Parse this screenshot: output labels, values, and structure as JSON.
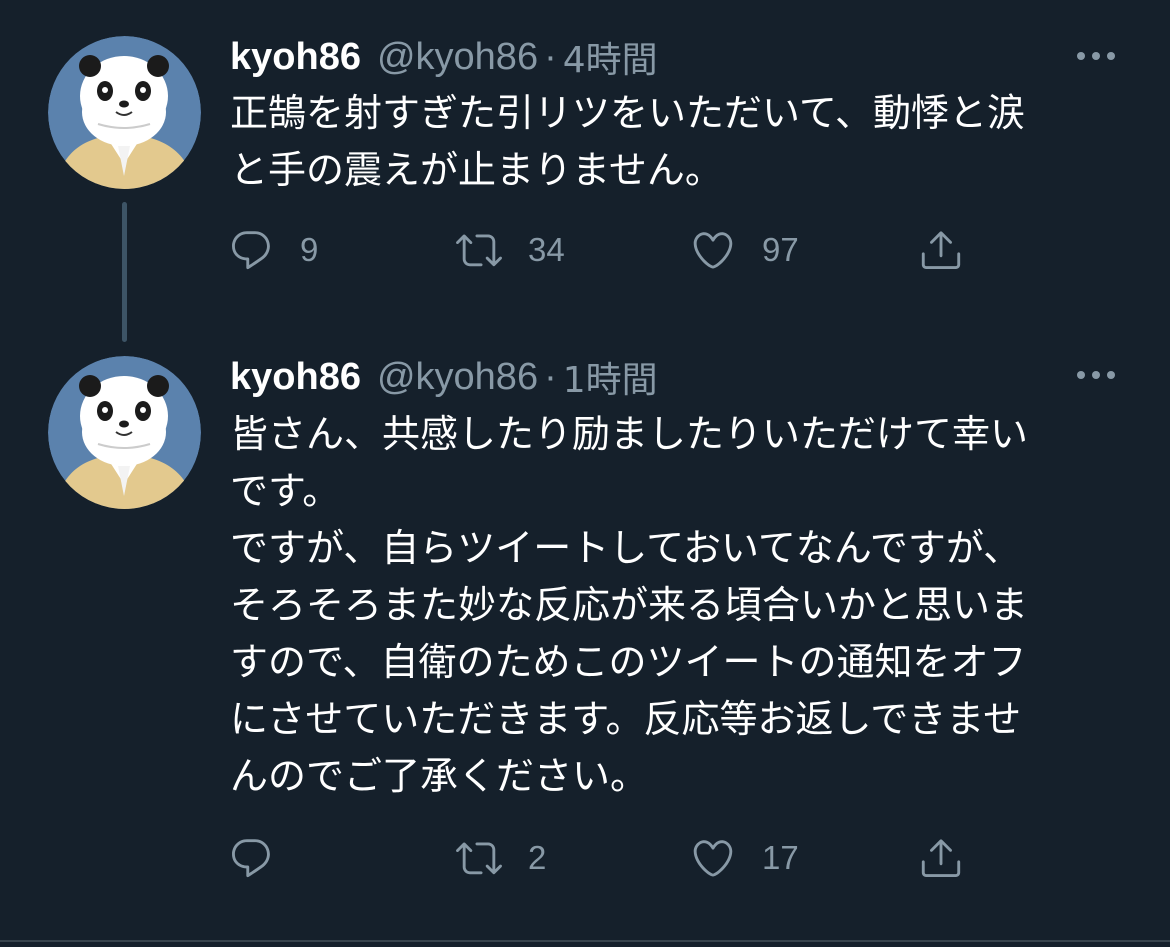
{
  "colors": {
    "background": "#15202b",
    "text_primary": "#ffffff",
    "text_secondary": "#8899a6",
    "thread_line": "#3d5466",
    "avatar_background": "#5b82ad"
  },
  "tweets": [
    {
      "display_name": "kyoh86",
      "handle": "@kyoh86",
      "separator": "·",
      "time": "4時間",
      "text": "正鵠を射すぎた引リツをいただいて、動悸と涙\nと手の震えが止まりません。",
      "reply_count": "9",
      "retweet_count": "34",
      "like_count": "97"
    },
    {
      "display_name": "kyoh86",
      "handle": "@kyoh86",
      "separator": "·",
      "time": "1時間",
      "text": "皆さん、共感したり励ましたりいただけて幸い\nです。\nですが、自らツイートしておいてなんですが、\nそろそろまた妙な反応が来る頃合いかと思いま\nすので、自衛のためこのツイートの通知をオフ\nにさせていただきます。反応等お返しできませ\nんのでご了承ください。",
      "reply_count": "",
      "retweet_count": "2",
      "like_count": "17"
    }
  ],
  "icons": {
    "avatar": "panda-avatar-icon",
    "more": "more-dots-icon",
    "reply": "reply-icon",
    "retweet": "retweet-icon",
    "like": "heart-icon",
    "share": "share-icon"
  }
}
